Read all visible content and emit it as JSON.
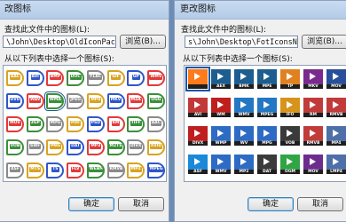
{
  "left_dialog": {
    "title": "改图标",
    "look_label": "查找此文件中的图标(L):",
    "path": "\\John\\Desktop\\OldIconPack.dll",
    "browse_label": "浏览(B)...",
    "list_label": "从以下列表中选择一个图标(S):",
    "ok_label": "确定",
    "cancel_label": "取消",
    "icons": [
      [
        "AAC",
        "AVI",
        "BMP",
        "DOC",
        "FLAC",
        "GIF",
        "GP",
        "WMV"
      ],
      [
        "DVD",
        "WAV",
        "WMA",
        "JPEG",
        "MP4",
        "MKV",
        "M4A",
        "OGG"
      ],
      [
        "MOV",
        "3GP",
        "MPG",
        "PDF",
        "PSD",
        "RM",
        "TIFF",
        "AAC"
      ],
      [
        "VOB",
        "SWF",
        "PNG",
        "DAT",
        "MP3",
        "M2TS",
        "DIVX",
        "XVID"
      ],
      [
        "ASF",
        "MTS",
        "TS",
        "FLV",
        "WEBM",
        "RMVB",
        "MP2",
        "MPEG"
      ]
    ],
    "badge_colors": [
      "#d8a320",
      "#2f57c9",
      "#e23a3a",
      "#3a8f3a",
      "#8a8a8a"
    ]
  },
  "right_dialog": {
    "title": "更改图标",
    "look_label": "查找此文件中的图标(L):",
    "path": "s\\John\\Desktop\\FotIconsNew.dll",
    "browse_label": "浏览(B)...",
    "list_label": "从以下列表中选择一个图标(S):",
    "ok_label": "确定",
    "cancel_label": "取消",
    "icons": [
      [
        "",
        "AEX",
        "BMK",
        "MPE",
        "TP",
        "MKV",
        "MOV"
      ],
      [
        "AVI",
        "WM",
        "WMV",
        "MPEG",
        "IFO",
        "RM",
        "RMVB"
      ],
      [
        "DIVX",
        "WMP",
        "WV",
        "MPG",
        "VOB",
        "RMVB",
        "MP4"
      ],
      [
        "ASF",
        "WMV",
        "MP2",
        "DAT",
        "OGM",
        "MOV",
        "LMP4"
      ]
    ],
    "tile_colors": [
      [
        "#ff7a1a",
        "#1d5d8f",
        "#1d5d8f",
        "#1d5d8f",
        "#e0811f",
        "#7a2a8f",
        "#2a4f9a"
      ],
      [
        "#c23838",
        "#bf1f1f",
        "#2477c2",
        "#2477c2",
        "#d8931a",
        "#c13b3b",
        "#c13b3b"
      ],
      [
        "#bf1f1f",
        "#2d6bc4",
        "#2d6bc4",
        "#2d6bc4",
        "#3a3a3a",
        "#c13b3b",
        "#4e6fa8"
      ],
      [
        "#1a89d9",
        "#2d6bc4",
        "#2d6bc4",
        "#3a3a3a",
        "#2fa544",
        "#6d2d8f",
        "#4e6fa8"
      ]
    ]
  }
}
